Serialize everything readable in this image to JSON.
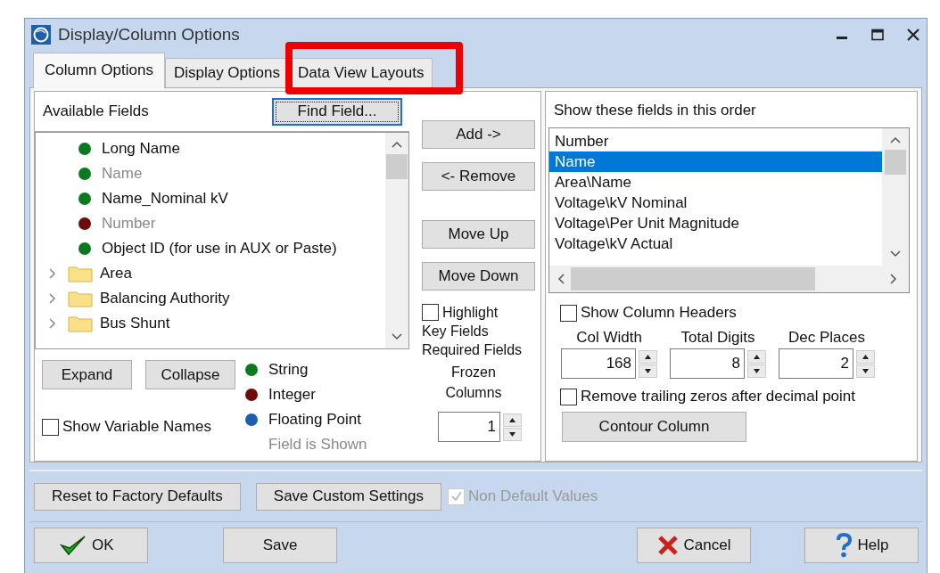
{
  "window": {
    "title": "Display/Column Options"
  },
  "tabs": [
    {
      "label": "Column Options",
      "selected": true,
      "highlighted": false
    },
    {
      "label": "Display Options",
      "selected": false,
      "highlighted": false
    },
    {
      "label": "Data View Layouts",
      "selected": false,
      "highlighted": true
    }
  ],
  "available_fields": {
    "label": "Available Fields",
    "find_button": {
      "label": "Find Field...",
      "focused": true
    },
    "items": [
      {
        "kind": "field",
        "label": "Long Name",
        "color": "#0b7a1f",
        "shown": false
      },
      {
        "kind": "field",
        "label": "Name",
        "color": "#0b7a1f",
        "shown": true
      },
      {
        "kind": "field",
        "label": "Name_Nominal kV",
        "color": "#0b7a1f",
        "shown": false
      },
      {
        "kind": "field",
        "label": "Number",
        "color": "#6e0a0a",
        "shown": true
      },
      {
        "kind": "field",
        "label": "Object ID (for use in AUX or Paste)",
        "color": "#0b7a1f",
        "shown": false
      },
      {
        "kind": "folder",
        "label": "Area"
      },
      {
        "kind": "folder",
        "label": "Balancing Authority"
      },
      {
        "kind": "folder",
        "label": "Bus Shunt"
      }
    ],
    "expand_button": "Expand",
    "collapse_button": "Collapse",
    "show_variable_names": {
      "label": "Show Variable Names",
      "checked": false
    },
    "legend": [
      {
        "label": "String",
        "color": "#0b7a1f"
      },
      {
        "label": "Integer",
        "color": "#6e0a0a"
      },
      {
        "label": "Floating Point",
        "color": "#1c5fb0"
      }
    ],
    "shown_note": "Field is Shown"
  },
  "middle": {
    "buttons": [
      "Add ->",
      "<- Remove",
      "Move Up",
      "Move Down"
    ],
    "highlight": {
      "label": "Highlight",
      "checked": false
    },
    "key_fields": "Key Fields",
    "required_fields": "Required Fields",
    "frozen_label": "Frozen Columns",
    "frozen_value": "1"
  },
  "selected_fields": {
    "label": "Show these fields in this order",
    "items": [
      {
        "label": "Number",
        "selected": false
      },
      {
        "label": "Name",
        "selected": true
      },
      {
        "label": "Area\\Name",
        "selected": false
      },
      {
        "label": "Voltage\\kV Nominal",
        "selected": false
      },
      {
        "label": "Voltage\\Per Unit Magnitude",
        "selected": false
      },
      {
        "label": "Voltage\\kV Actual",
        "selected": false
      }
    ],
    "show_column_headers": {
      "label": "Show Column Headers",
      "checked": false
    },
    "spinners": [
      {
        "label": "Col Width",
        "value": "168"
      },
      {
        "label": "Total Digits",
        "value": "8"
      },
      {
        "label": "Dec Places",
        "value": "2"
      }
    ],
    "remove_trailing_zeros": {
      "label": "Remove trailing zeros after decimal point",
      "checked": false
    },
    "contour_button": "Contour Column"
  },
  "bottom_bar": {
    "buttons": [
      "Reset to Factory Defaults",
      "Save Custom Settings"
    ],
    "non_default_values": {
      "label": "Non Default Values",
      "checked": true,
      "disabled": true
    }
  },
  "footer": [
    {
      "kind": "ok",
      "label": "OK"
    },
    {
      "kind": "plain",
      "label": "Save"
    },
    {
      "kind": "cancel",
      "label": "Cancel"
    },
    {
      "kind": "help",
      "label": "Help"
    }
  ]
}
